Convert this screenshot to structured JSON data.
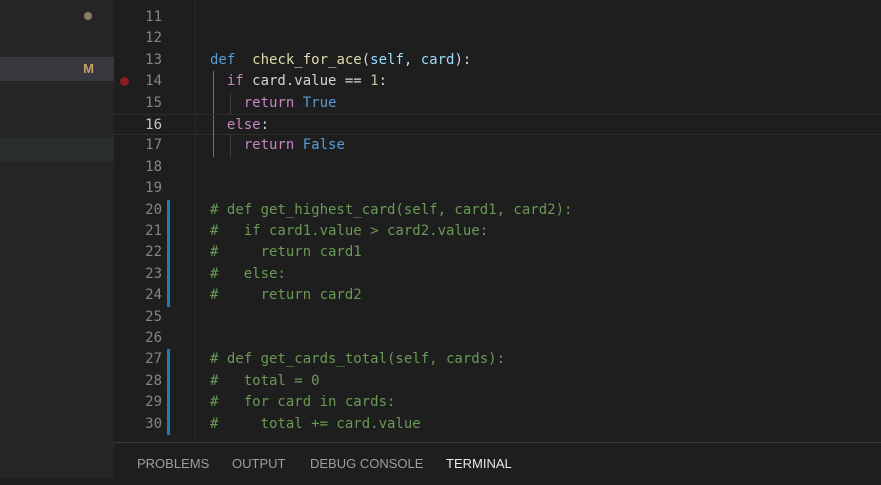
{
  "sidebar": {
    "modified_badge": "M"
  },
  "editor": {
    "lines": [
      {
        "n": "11",
        "text": ""
      },
      {
        "n": "12",
        "text": ""
      },
      {
        "n": "13",
        "tokens": [
          [
            "kw",
            "def"
          ],
          [
            "",
            "  "
          ],
          [
            "fn",
            "check_for_ace"
          ],
          [
            "",
            "("
          ],
          [
            "par",
            "self"
          ],
          [
            "",
            ", "
          ],
          [
            "par",
            "card"
          ],
          [
            "",
            "):"
          ]
        ]
      },
      {
        "n": "14",
        "tokens": [
          [
            "",
            "  "
          ],
          [
            "ctl",
            "if"
          ],
          [
            "",
            " card.value == "
          ],
          [
            "num",
            "1"
          ],
          [
            "",
            ":"
          ]
        ],
        "breakpoint": true
      },
      {
        "n": "15",
        "tokens": [
          [
            "",
            "    "
          ],
          [
            "ctl",
            "return"
          ],
          [
            "",
            " "
          ],
          [
            "kw",
            "True"
          ]
        ]
      },
      {
        "n": "16",
        "tokens": [
          [
            "",
            "  "
          ],
          [
            "ctl",
            "else"
          ],
          [
            "",
            ":"
          ]
        ],
        "current": true
      },
      {
        "n": "17",
        "tokens": [
          [
            "",
            "    "
          ],
          [
            "ctl",
            "return"
          ],
          [
            "",
            " "
          ],
          [
            "kw",
            "False"
          ]
        ]
      },
      {
        "n": "18",
        "text": ""
      },
      {
        "n": "19",
        "text": ""
      },
      {
        "n": "20",
        "tokens": [
          [
            "cmt",
            "# def get_highest_card(self, card1, card2):"
          ]
        ],
        "git": true
      },
      {
        "n": "21",
        "tokens": [
          [
            "cmt",
            "#   if card1.value > card2.value:"
          ]
        ],
        "git": true
      },
      {
        "n": "22",
        "tokens": [
          [
            "cmt",
            "#     return card1"
          ]
        ],
        "git": true
      },
      {
        "n": "23",
        "tokens": [
          [
            "cmt",
            "#   else:"
          ]
        ],
        "git": true
      },
      {
        "n": "24",
        "tokens": [
          [
            "cmt",
            "#     return card2"
          ]
        ],
        "git": true
      },
      {
        "n": "25",
        "text": ""
      },
      {
        "n": "26",
        "text": ""
      },
      {
        "n": "27",
        "tokens": [
          [
            "cmt",
            "# def get_cards_total(self, cards):"
          ]
        ],
        "git": true
      },
      {
        "n": "28",
        "tokens": [
          [
            "cmt",
            "#   total = 0"
          ]
        ],
        "git": true
      },
      {
        "n": "29",
        "tokens": [
          [
            "cmt",
            "#   for card in cards:"
          ]
        ],
        "git": true
      },
      {
        "n": "30",
        "tokens": [
          [
            "cmt",
            "#     total += card.value"
          ]
        ],
        "git": true
      }
    ]
  },
  "panel": {
    "tabs": [
      {
        "label": "PROBLEMS",
        "active": false
      },
      {
        "label": "OUTPUT",
        "active": false
      },
      {
        "label": "DEBUG CONSOLE",
        "active": false
      },
      {
        "label": "TERMINAL",
        "active": true
      }
    ]
  }
}
